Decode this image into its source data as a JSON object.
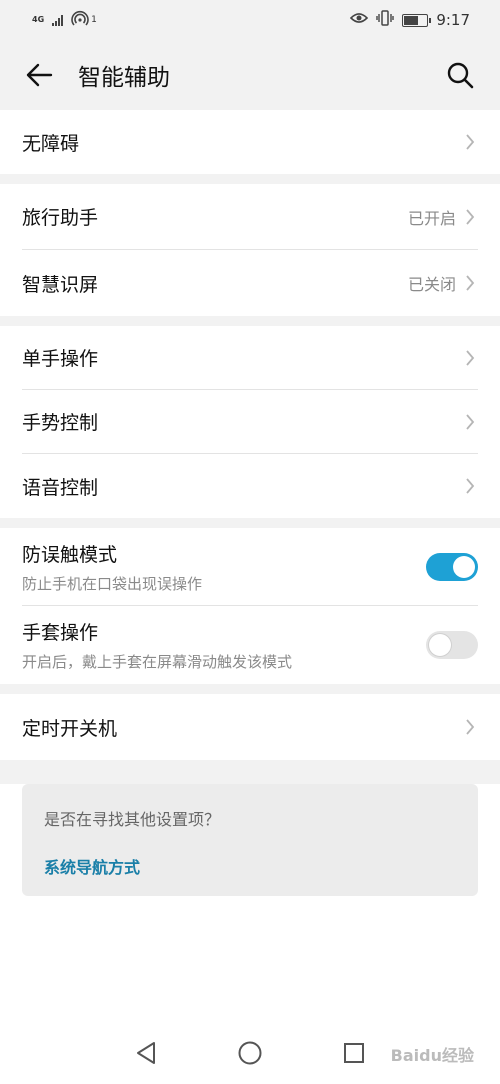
{
  "status_bar": {
    "network": "4G",
    "signal_superscript": "1",
    "time": "9:17",
    "icons": [
      "signal-icon",
      "hotspot-icon",
      "eye-comfort-icon",
      "vibrate-icon",
      "battery-icon"
    ]
  },
  "header": {
    "title": "智能辅助",
    "back_icon": "arrow-left-icon",
    "search_icon": "search-icon"
  },
  "groups": [
    {
      "items": [
        {
          "label": "无障碍"
        }
      ]
    },
    {
      "items": [
        {
          "label": "旅行助手",
          "value": "已开启"
        },
        {
          "label": "智慧识屏",
          "value": "已关闭"
        }
      ]
    },
    {
      "items": [
        {
          "label": "单手操作"
        },
        {
          "label": "手势控制"
        },
        {
          "label": "语音控制"
        }
      ]
    },
    {
      "toggles": [
        {
          "label": "防误触模式",
          "desc": "防止手机在口袋出现误操作",
          "on": true
        },
        {
          "label": "手套操作",
          "desc": "开启后，戴上手套在屏幕滑动触发该模式",
          "on": false
        }
      ]
    },
    {
      "items": [
        {
          "label": "定时开关机"
        }
      ]
    }
  ],
  "suggestion": {
    "question": "是否在寻找其他设置项？",
    "link": "系统导航方式"
  },
  "colors": {
    "accent": "#1ea1d5",
    "link": "#1a7fa8",
    "background": "#f2f2f2"
  },
  "navbar": {
    "icons": [
      "nav-back-icon",
      "nav-home-icon",
      "nav-recents-icon"
    ]
  },
  "watermark": "Baidu经验"
}
